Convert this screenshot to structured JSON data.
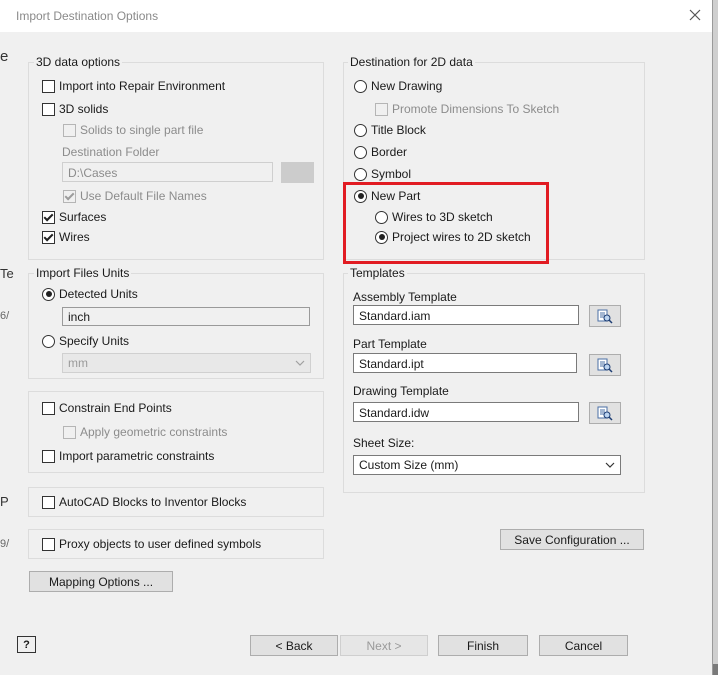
{
  "window": {
    "title": "Import Destination Options"
  },
  "data3d": {
    "title": "3D data options",
    "import_repair": {
      "label": "Import into Repair Environment",
      "checked": false
    },
    "solids": {
      "label": "3D solids",
      "checked": false
    },
    "solids_single": {
      "label": "Solids to single part file",
      "checked": false
    },
    "dest_folder_label": "Destination Folder",
    "dest_folder_value": "D:\\Cases",
    "use_default_names": {
      "label": "Use Default File Names",
      "checked": true
    },
    "surfaces": {
      "label": "Surfaces",
      "checked": true
    },
    "wires": {
      "label": "Wires",
      "checked": true
    }
  },
  "units": {
    "title": "Import Files Units",
    "detected": {
      "label": "Detected Units",
      "selected": true
    },
    "detected_value": "inch",
    "specify": {
      "label": "Specify Units",
      "selected": false
    },
    "specify_value": "mm"
  },
  "constraints": {
    "end_points": {
      "label": "Constrain End Points",
      "checked": false
    },
    "geometric": {
      "label": "Apply geometric constraints",
      "checked": false
    },
    "parametric": {
      "label": "Import parametric constraints",
      "checked": false
    }
  },
  "autocad_blocks": {
    "label": "AutoCAD Blocks to Inventor Blocks",
    "checked": false
  },
  "proxy": {
    "label": "Proxy objects to user defined symbols",
    "checked": false
  },
  "mapping_button": "Mapping Options ...",
  "dest2d": {
    "title": "Destination for 2D data",
    "new_drawing": {
      "label": "New Drawing",
      "selected": false
    },
    "promote_dims": {
      "label": "Promote Dimensions To Sketch",
      "checked": false
    },
    "title_block": {
      "label": "Title Block",
      "selected": false
    },
    "border": {
      "label": "Border",
      "selected": false
    },
    "symbol": {
      "label": "Symbol",
      "selected": false
    },
    "new_part": {
      "label": "New Part",
      "selected": true
    },
    "wires_3d": {
      "label": "Wires to 3D sketch",
      "selected": false
    },
    "project_2d": {
      "label": "Project wires to 2D sketch",
      "selected": true
    }
  },
  "templates": {
    "title": "Templates",
    "assembly_label": "Assembly Template",
    "assembly_value": "Standard.iam",
    "part_label": "Part Template",
    "part_value": "Standard.ipt",
    "drawing_label": "Drawing Template",
    "drawing_value": "Standard.idw",
    "sheet_label": "Sheet Size:",
    "sheet_value": "Custom Size (mm)"
  },
  "save_config_button": "Save Configuration ...",
  "footer": {
    "help": "?",
    "back": "< Back",
    "next": "Next >",
    "finish": "Finish",
    "cancel": "Cancel"
  },
  "background": {
    "frag_e": "e",
    "frag_te": "Te",
    "frag_6": "6/",
    "frag_p": "P",
    "frag_9": "9/"
  },
  "colors": {
    "highlight": "#e11b22",
    "dialog_bg": "#f0f0f0"
  }
}
